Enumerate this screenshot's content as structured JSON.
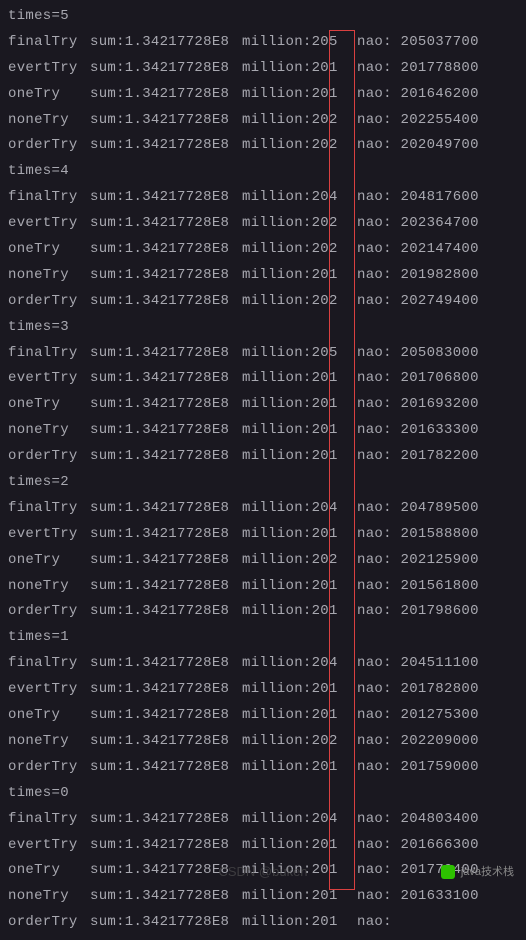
{
  "console": {
    "header_partial": {
      "name": "orderTry",
      "sum": "sum:1.34217728E8",
      "million": "million:201",
      "nao": "nao: "
    },
    "groups": [
      {
        "times_label": "times=5",
        "rows": [
          {
            "name": "finalTry",
            "sum": "sum:1.34217728E8",
            "million": "million:205",
            "nao": "nao: 205037700"
          },
          {
            "name": "evertTry",
            "sum": "sum:1.34217728E8",
            "million": "million:201",
            "nao": "nao: 201778800"
          },
          {
            "name": "oneTry",
            "sum": "sum:1.34217728E8",
            "million": "million:201",
            "nao": "nao: 201646200"
          },
          {
            "name": "noneTry",
            "sum": "sum:1.34217728E8",
            "million": "million:202",
            "nao": "nao: 202255400"
          },
          {
            "name": "orderTry",
            "sum": "sum:1.34217728E8",
            "million": "million:202",
            "nao": "nao: 202049700"
          }
        ]
      },
      {
        "times_label": "times=4",
        "rows": [
          {
            "name": "finalTry",
            "sum": "sum:1.34217728E8",
            "million": "million:204",
            "nao": "nao: 204817600"
          },
          {
            "name": "evertTry",
            "sum": "sum:1.34217728E8",
            "million": "million:202",
            "nao": "nao: 202364700"
          },
          {
            "name": "oneTry",
            "sum": "sum:1.34217728E8",
            "million": "million:202",
            "nao": "nao: 202147400"
          },
          {
            "name": "noneTry",
            "sum": "sum:1.34217728E8",
            "million": "million:201",
            "nao": "nao: 201982800"
          },
          {
            "name": "orderTry",
            "sum": "sum:1.34217728E8",
            "million": "million:202",
            "nao": "nao: 202749400"
          }
        ]
      },
      {
        "times_label": "times=3",
        "rows": [
          {
            "name": "finalTry",
            "sum": "sum:1.34217728E8",
            "million": "million:205",
            "nao": "nao: 205083000"
          },
          {
            "name": "evertTry",
            "sum": "sum:1.34217728E8",
            "million": "million:201",
            "nao": "nao: 201706800"
          },
          {
            "name": "oneTry",
            "sum": "sum:1.34217728E8",
            "million": "million:201",
            "nao": "nao: 201693200"
          },
          {
            "name": "noneTry",
            "sum": "sum:1.34217728E8",
            "million": "million:201",
            "nao": "nao: 201633300"
          },
          {
            "name": "orderTry",
            "sum": "sum:1.34217728E8",
            "million": "million:201",
            "nao": "nao: 201782200"
          }
        ]
      },
      {
        "times_label": "times=2",
        "rows": [
          {
            "name": "finalTry",
            "sum": "sum:1.34217728E8",
            "million": "million:204",
            "nao": "nao: 204789500"
          },
          {
            "name": "evertTry",
            "sum": "sum:1.34217728E8",
            "million": "million:201",
            "nao": "nao: 201588800"
          },
          {
            "name": "oneTry",
            "sum": "sum:1.34217728E8",
            "million": "million:202",
            "nao": "nao: 202125900"
          },
          {
            "name": "noneTry",
            "sum": "sum:1.34217728E8",
            "million": "million:201",
            "nao": "nao: 201561800"
          },
          {
            "name": "orderTry",
            "sum": "sum:1.34217728E8",
            "million": "million:201",
            "nao": "nao: 201798600"
          }
        ]
      },
      {
        "times_label": "times=1",
        "rows": [
          {
            "name": "finalTry",
            "sum": "sum:1.34217728E8",
            "million": "million:204",
            "nao": "nao: 204511100"
          },
          {
            "name": "evertTry",
            "sum": "sum:1.34217728E8",
            "million": "million:201",
            "nao": "nao: 201782800"
          },
          {
            "name": "oneTry",
            "sum": "sum:1.34217728E8",
            "million": "million:201",
            "nao": "nao: 201275300"
          },
          {
            "name": "noneTry",
            "sum": "sum:1.34217728E8",
            "million": "million:202",
            "nao": "nao: 202209000"
          },
          {
            "name": "orderTry",
            "sum": "sum:1.34217728E8",
            "million": "million:201",
            "nao": "nao: 201759000"
          }
        ]
      },
      {
        "times_label": "times=0",
        "rows": [
          {
            "name": "finalTry",
            "sum": "sum:1.34217728E8",
            "million": "million:204",
            "nao": "nao: 204803400"
          },
          {
            "name": "evertTry",
            "sum": "sum:1.34217728E8",
            "million": "million:201",
            "nao": "nao: 201666300"
          },
          {
            "name": "oneTry",
            "sum": "sum:1.34217728E8",
            "million": "million:201",
            "nao": "nao: 201779400"
          },
          {
            "name": "noneTry",
            "sum": "sum:1.34217728E8",
            "million": "million:201",
            "nao": "nao: 201633100"
          },
          {
            "name": "orderTry",
            "sum": "sum:1.34217728E8",
            "million": "million:201",
            "nao": "nao: "
          }
        ]
      }
    ]
  },
  "watermark": {
    "main": "CSDN @buken",
    "wechat": "java技术栈"
  }
}
